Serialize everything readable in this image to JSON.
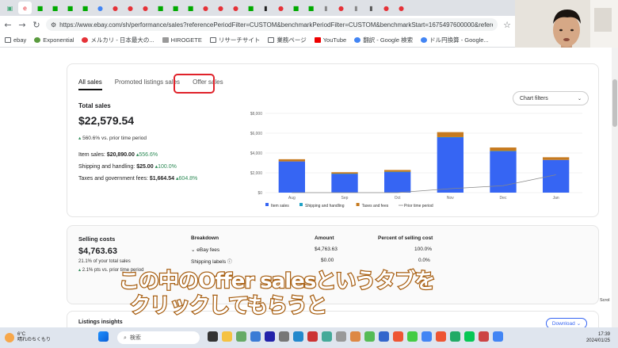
{
  "browser": {
    "url": "https://www.ebay.com/sh/performance/sales?referencePeriodFilter=CUSTOM&benchmarkPeriodFilter=CUSTOM&benchmarkStart=1675497600000&referenceEnd=17061...",
    "bookmarks": [
      "ebay",
      "Exponential",
      "メルカリ - 日本最大の...",
      "HIROGETE",
      "リサーチサイト",
      "業務ページ",
      "YouTube",
      "翻訳 - Google 検索",
      "ドル円換算 - Google..."
    ]
  },
  "tabs": {
    "all_sales": "All sales",
    "promoted": "Promoted listings sales",
    "offer": "Offer sales"
  },
  "chart_filters": "Chart filters",
  "total_sales": {
    "label": "Total sales",
    "value": "$22,579.54",
    "change": "560.6%",
    "change_suffix": "vs. prior time period"
  },
  "metrics": [
    {
      "label": "Item sales:",
      "value": "$20,890.00",
      "change": "556.6%"
    },
    {
      "label": "Shipping and handling:",
      "value": "$25.00",
      "change": "100.0%"
    },
    {
      "label": "Taxes and government fees:",
      "value": "$1,664.54",
      "change": "604.8%"
    }
  ],
  "chart_data": {
    "type": "bar",
    "categories": [
      "Aug",
      "Sep",
      "Oct",
      "Nov",
      "Dec",
      "Jan"
    ],
    "series": [
      {
        "name": "Item sales",
        "values": [
          3150,
          1900,
          2100,
          5600,
          4200,
          3300
        ],
        "color": "#3665f3"
      },
      {
        "name": "Shipping and handling",
        "values": [
          0,
          10,
          5,
          5,
          5,
          0
        ],
        "color": "#1fa2c6"
      },
      {
        "name": "Taxes and fees",
        "values": [
          220,
          150,
          180,
          500,
          350,
          270
        ],
        "color": "#c67a1f"
      },
      {
        "name": "Prior time period",
        "values": [
          0,
          0,
          0,
          400,
          700,
          1800
        ],
        "color": "#888888"
      }
    ],
    "yticks": [
      "$0",
      "$2,000",
      "$4,000",
      "$6,000",
      "$8,000"
    ],
    "ylim": [
      0,
      8000
    ],
    "legend": [
      "Item sales",
      "Shipping and handling",
      "Taxes and fees",
      "Prior time period"
    ]
  },
  "selling_costs": {
    "label": "Selling costs",
    "value": "$4,763.63",
    "sub": "21.1% of your total sales",
    "change": "2.1% pts",
    "change_suffix": "vs. prior time period",
    "headers": [
      "Breakdown",
      "Amount",
      "Percent of selling cost"
    ],
    "rows": [
      {
        "name": "eBay fees",
        "amount": "$4,763.63",
        "percent": "100.0%"
      },
      {
        "name": "Shipping labels",
        "amount": "$0.00",
        "percent": "0.0%"
      }
    ]
  },
  "listings_insights": "Listings insights",
  "download": "Download",
  "subtitle": {
    "line1": "この中のOffer salesというタブを",
    "line2": "クリックしてもらうと"
  },
  "taskbar": {
    "temp": "6°C",
    "weather": "晴れのちくもり",
    "search": "検索",
    "time": "17:39",
    "date": "2024/01/25"
  },
  "scroll_label": "Scrol"
}
